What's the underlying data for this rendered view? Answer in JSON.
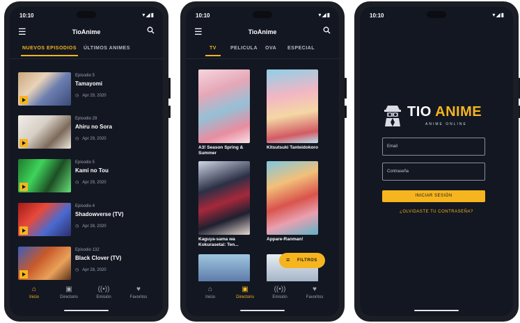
{
  "status_time": "10:10",
  "app_title": "TioAnime",
  "icons": {
    "menu": "hamburger-menu-icon",
    "search": "search-icon",
    "play": "play-icon",
    "clock": "clock-icon",
    "filter": "filter-icon"
  },
  "colors": {
    "accent": "#f6b51e",
    "background": "#131722"
  },
  "screen1": {
    "tabs": [
      "NUEVOS EPISODIOS",
      "ÚLTIMOS ANIMES"
    ],
    "episodes": [
      {
        "episode": "Episodio 5",
        "title": "Tamayomi",
        "date": "Apr 29, 2020"
      },
      {
        "episode": "Episodio 29",
        "title": "Ahiru no Sora",
        "date": "Apr 29, 2020"
      },
      {
        "episode": "Episodio 5",
        "title": "Kami no Tou",
        "date": "Apr 29, 2020"
      },
      {
        "episode": "Episodio 4",
        "title": "Shadowverse (TV)",
        "date": "Apr 28, 2020"
      },
      {
        "episode": "Episodio 132",
        "title": "Black Clover (TV)",
        "date": "Apr 28, 2020"
      }
    ]
  },
  "screen2": {
    "tabs": [
      "TV",
      "PELICULA",
      "OVA",
      "ESPECIAL"
    ],
    "grid": [
      {
        "title": "A3! Season Spring & Summer"
      },
      {
        "title": "Kitsutsuki Tanteidokoro"
      },
      {
        "title": "Kaguya-sama wa Kokurasetai: Ten..."
      },
      {
        "title": "Appare-Ranman!"
      }
    ],
    "fab_label": "FILTROS"
  },
  "screen3": {
    "brand_part1": "TIO ",
    "brand_part2": "ANIME",
    "brand_sub": "ANIME ONLINE",
    "email_placeholder": "Email",
    "password_placeholder": "Contraseña",
    "login_button": "INICIAR SESIÓN",
    "forgot_link": "¿OLVIDASTE TU CONTRASEÑA?"
  },
  "nav": [
    {
      "label": "Inicio",
      "icon": "home-icon"
    },
    {
      "label": "Directorio",
      "icon": "library-icon"
    },
    {
      "label": "Emisión",
      "icon": "broadcast-icon"
    },
    {
      "label": "Favoritos",
      "icon": "heart-icon"
    }
  ],
  "nav_active": {
    "screen1": "Inicio",
    "screen2": "Directorio"
  }
}
